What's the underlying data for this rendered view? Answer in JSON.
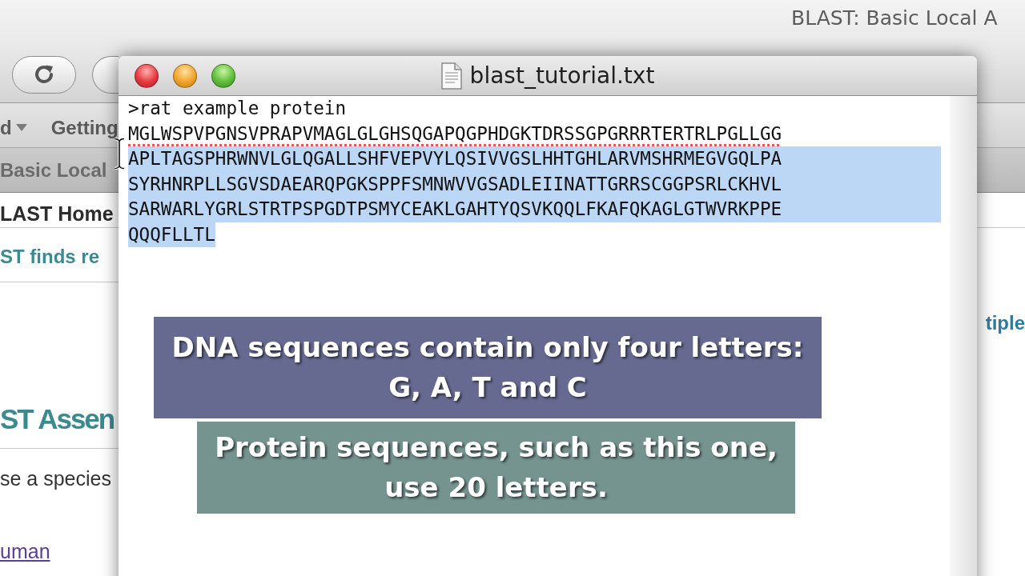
{
  "browser": {
    "title": "BLAST: Basic Local A",
    "bookmarks": [
      {
        "label": "d",
        "kind": "menu"
      },
      {
        "label": "Getting",
        "kind": "link"
      }
    ],
    "tab": {
      "label": "Basic Local"
    },
    "page": {
      "heading": "LAST Home",
      "intro": "ST finds re",
      "side_link": "tiple",
      "section_heading": "ST Assen",
      "prompt": "se a species",
      "species_link": "uman"
    }
  },
  "editor": {
    "title": "blast_tutorial.txt",
    "lines": [
      {
        "text": ">rat example protein",
        "selected": false,
        "misspelled": false
      },
      {
        "text": "MGLWSPVPGNSVPRAPVMAGLGLGHSQGAPQGPHDGKTDRSSGPGRRRTERTRLPGLLGG",
        "selected": false,
        "misspelled": true
      },
      {
        "text": "APLTAGSPHRWNVLGLQGALLSHFVEPVYLQSIVVGSLHHTGHLARVMSHRMEGVGQLPA",
        "selected": true,
        "misspelled": false
      },
      {
        "text": "SYRHNRPLLSGVSDAEARQPGKSPPFSMNWVVGSADLEIINATTGRRSCGGPSRLCKHVL",
        "selected": true,
        "misspelled": false
      },
      {
        "text": "SARWARLYGRLSTRTPSPGDTPSMYCEAKLGAHTYQSVKQQLFKAFQKAGLGTWVRKPPE",
        "selected": true,
        "misspelled": false
      },
      {
        "text": "QQQFLLTL",
        "selected": true,
        "misspelled": false
      }
    ]
  },
  "captions": [
    {
      "text": "DNA sequences contain only four letters: G, A, T and C",
      "color": "#666a90"
    },
    {
      "text": "Protein sequences, such as this one, use 20 letters.",
      "color": "#75938f"
    }
  ]
}
